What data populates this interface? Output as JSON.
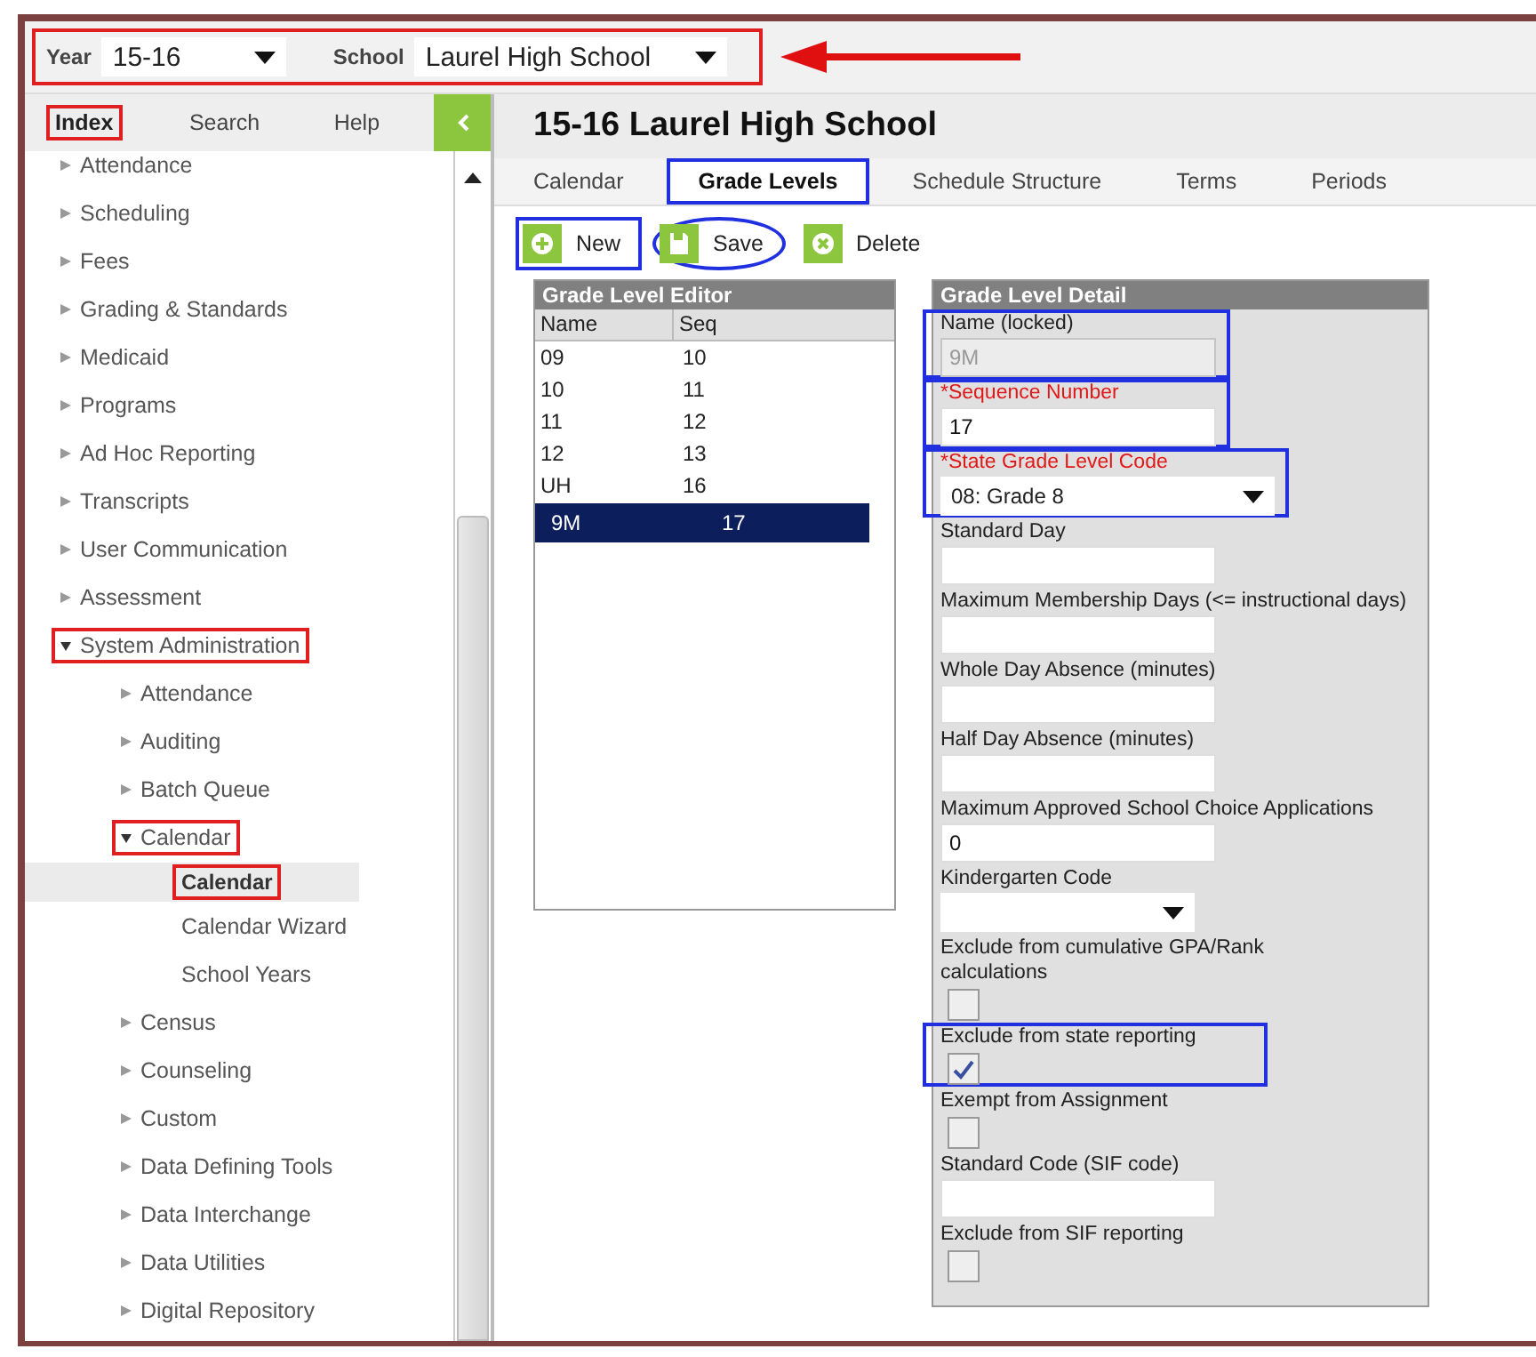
{
  "top_bar": {
    "highlighted": true,
    "arrow": true,
    "fields": [
      {
        "label": "Year",
        "value": "15-16",
        "kind": "year"
      },
      {
        "label": "School",
        "value": "Laurel High School",
        "kind": "school"
      }
    ]
  },
  "sidebar": {
    "tabs": [
      {
        "label": "Index",
        "selected": true,
        "highlighted": true
      },
      {
        "label": "Search",
        "selected": false,
        "highlighted": false
      },
      {
        "label": "Help",
        "selected": false,
        "highlighted": false
      }
    ],
    "items": [
      {
        "label": "Attendance",
        "expanded": false,
        "selected": false,
        "highlighted": false
      },
      {
        "label": "Scheduling",
        "expanded": false,
        "selected": false,
        "highlighted": false
      },
      {
        "label": "Fees",
        "expanded": false,
        "selected": false,
        "highlighted": false
      },
      {
        "label": "Grading & Standards",
        "expanded": false,
        "selected": false,
        "highlighted": false
      },
      {
        "label": "Medicaid",
        "expanded": false,
        "selected": false,
        "highlighted": false
      },
      {
        "label": "Programs",
        "expanded": false,
        "selected": false,
        "highlighted": false
      },
      {
        "label": "Ad Hoc Reporting",
        "expanded": false,
        "selected": false,
        "highlighted": false
      },
      {
        "label": "Transcripts",
        "expanded": false,
        "selected": false,
        "highlighted": false
      },
      {
        "label": "User Communication",
        "expanded": false,
        "selected": false,
        "highlighted": false
      },
      {
        "label": "Assessment",
        "expanded": false,
        "selected": false,
        "highlighted": false
      },
      {
        "label": "System Administration",
        "expanded": true,
        "selected": false,
        "highlighted": true,
        "children": [
          {
            "label": "Attendance",
            "expanded": false,
            "selected": false,
            "highlighted": false
          },
          {
            "label": "Auditing",
            "expanded": false,
            "selected": false,
            "highlighted": false
          },
          {
            "label": "Batch Queue",
            "expanded": false,
            "selected": false,
            "highlighted": false
          },
          {
            "label": "Calendar",
            "expanded": true,
            "selected": false,
            "highlighted": true,
            "children": [
              {
                "label": "Calendar",
                "selected": true,
                "highlighted": true
              },
              {
                "label": "Calendar Wizard",
                "selected": false,
                "highlighted": false
              },
              {
                "label": "School Years",
                "selected": false,
                "highlighted": false
              }
            ]
          },
          {
            "label": "Census",
            "expanded": false,
            "selected": false,
            "highlighted": false
          },
          {
            "label": "Counseling",
            "expanded": false,
            "selected": false,
            "highlighted": false
          },
          {
            "label": "Custom",
            "expanded": false,
            "selected": false,
            "highlighted": false
          },
          {
            "label": "Data Defining Tools",
            "expanded": false,
            "selected": false,
            "highlighted": false
          },
          {
            "label": "Data Interchange",
            "expanded": false,
            "selected": false,
            "highlighted": false
          },
          {
            "label": "Data Utilities",
            "expanded": false,
            "selected": false,
            "highlighted": false
          },
          {
            "label": "Digital Repository",
            "expanded": false,
            "selected": false,
            "highlighted": false
          }
        ]
      }
    ]
  },
  "page": {
    "title": "15-16 Laurel High School",
    "tabs": [
      {
        "label": "Calendar",
        "selected": false,
        "highlighted": false
      },
      {
        "label": "Grade Levels",
        "selected": true,
        "highlighted": true
      },
      {
        "label": "Schedule Structure",
        "selected": false,
        "highlighted": false
      },
      {
        "label": "Terms",
        "selected": false,
        "highlighted": false
      },
      {
        "label": "Periods",
        "selected": false,
        "highlighted": false
      }
    ],
    "toolbar": [
      {
        "kind": "new",
        "label": "New",
        "highlighted": true,
        "circled": false
      },
      {
        "kind": "save",
        "label": "Save",
        "highlighted": false,
        "circled": true
      },
      {
        "kind": "delete",
        "label": "Delete",
        "highlighted": false,
        "circled": false
      }
    ]
  },
  "editor": {
    "title": "Grade Level Editor",
    "columns": [
      "Name",
      "Seq"
    ],
    "rows": [
      {
        "cells": [
          "09",
          "10"
        ],
        "selected": false
      },
      {
        "cells": [
          "10",
          "11"
        ],
        "selected": false
      },
      {
        "cells": [
          "11",
          "12"
        ],
        "selected": false
      },
      {
        "cells": [
          "12",
          "13"
        ],
        "selected": false
      },
      {
        "cells": [
          "UH",
          "16"
        ],
        "selected": false
      },
      {
        "cells": [
          "9M",
          "17"
        ],
        "selected": true
      }
    ]
  },
  "detail": {
    "title": "Grade Level Detail",
    "fields": [
      {
        "kind": "text",
        "label": "Name (locked)",
        "value": "9M",
        "disabled": true,
        "required": false,
        "highlighted": true
      },
      {
        "kind": "text",
        "label": "*Sequence Number",
        "value": "17",
        "disabled": false,
        "required": true,
        "highlighted": true
      },
      {
        "kind": "select",
        "label": "*State Grade Level Code",
        "value": "08: Grade 8",
        "required": true,
        "highlighted": true
      },
      {
        "kind": "text",
        "label": "Standard Day",
        "disabled": false,
        "required": false,
        "highlighted": false
      },
      {
        "kind": "text",
        "label": "Maximum Membership Days (<= instructional days)",
        "disabled": false,
        "required": false,
        "highlighted": false
      },
      {
        "kind": "text",
        "label": "Whole Day Absence (minutes)",
        "disabled": false,
        "required": false,
        "highlighted": false
      },
      {
        "kind": "text",
        "label": "Half Day Absence (minutes)",
        "disabled": false,
        "required": false,
        "highlighted": false
      },
      {
        "kind": "text",
        "label": "Maximum Approved School Choice Applications",
        "value": "0",
        "disabled": false,
        "required": false,
        "highlighted": false
      },
      {
        "kind": "select_small",
        "label": "Kindergarten Code",
        "required": false,
        "highlighted": false
      },
      {
        "kind": "checkbox",
        "label": "Exclude from cumulative GPA/Rank calculations",
        "checked": false,
        "required": false,
        "highlighted": false
      },
      {
        "kind": "checkbox",
        "label": "Exclude from state reporting",
        "checked": true,
        "required": false,
        "highlighted": true
      },
      {
        "kind": "checkbox",
        "label": "Exempt from Assignment",
        "checked": false,
        "required": false,
        "highlighted": false
      },
      {
        "kind": "text",
        "label": "Standard Code (SIF code)",
        "disabled": false,
        "required": false,
        "highlighted": false
      },
      {
        "kind": "checkbox",
        "label": "Exclude from SIF reporting",
        "checked": false,
        "required": false,
        "highlighted": false
      }
    ]
  }
}
